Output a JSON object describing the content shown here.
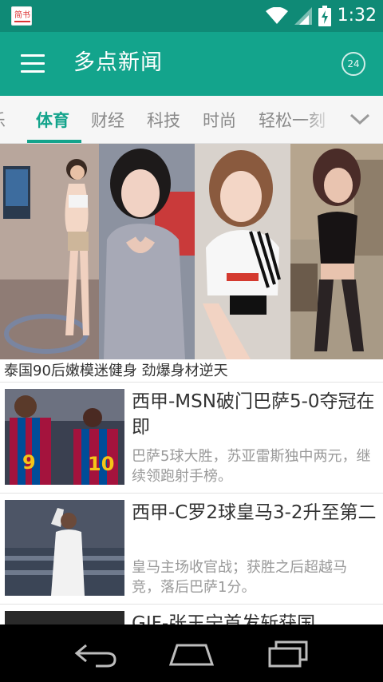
{
  "status_bar": {
    "app_icon_text": "简书",
    "time": "1:32",
    "icons": [
      "wifi-icon",
      "signal-icon",
      "battery-charging-icon"
    ]
  },
  "app_bar": {
    "title": "多点新闻",
    "history_badge": "24",
    "background": "#13a48c"
  },
  "tabs": {
    "items": [
      {
        "label": "乐"
      },
      {
        "label": "体育",
        "active": true
      },
      {
        "label": "财经"
      },
      {
        "label": "科技"
      },
      {
        "label": "时尚"
      },
      {
        "label": "轻松一刻"
      }
    ],
    "expand_icon": "chevron-down-icon",
    "accent": "#13a48c"
  },
  "gallery": {
    "photo_count": 4,
    "caption": "泰国90后嫩模迷健身 劲爆身材逆天"
  },
  "news": [
    {
      "title": "西甲-MSN破门巴萨5-0夺冠在即",
      "summary": "巴萨5球大胜，苏亚雷斯独中两元，继续领跑射手榜。",
      "thumb_jerseys": [
        "9",
        "10"
      ]
    },
    {
      "title": "西甲-C罗2球皇马3-2升至第二",
      "summary": "皇马主场收官战；获胜之后超越马竞，落后巴萨1分。"
    },
    {
      "title": "GIF-张玉宁首发斩获国",
      "summary": ""
    }
  ],
  "nav_bar": {
    "buttons": [
      "back-icon",
      "home-icon",
      "recents-icon"
    ]
  }
}
